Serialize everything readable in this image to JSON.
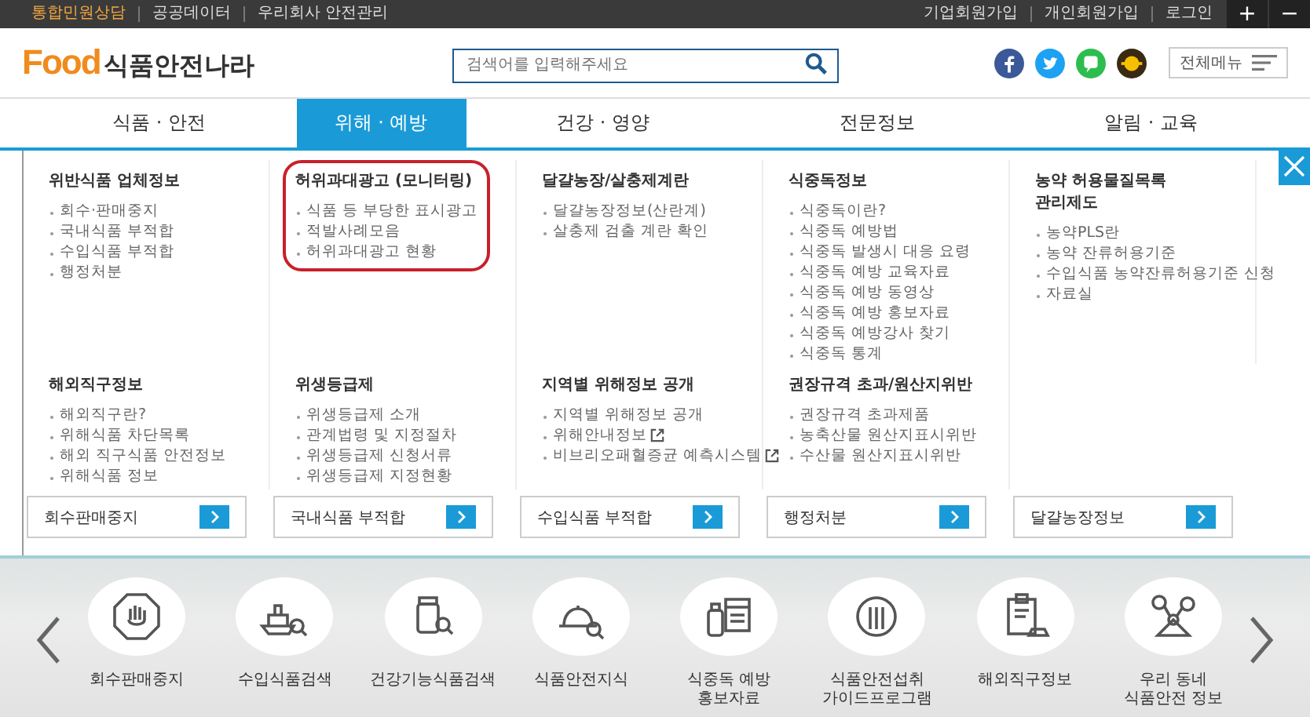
{
  "top_bar": {
    "left_links": [
      {
        "label": "통합민원상담",
        "highlight": true
      },
      {
        "label": "공공데이터",
        "highlight": false
      },
      {
        "label": "우리회사 안전관리",
        "highlight": false
      }
    ],
    "right_links": [
      "기업회원가입",
      "개인회원가입",
      "로그인"
    ],
    "zoom_buttons": [
      "+",
      "−"
    ]
  },
  "header": {
    "logo": {
      "mark": "Food",
      "name": "식품안전나라"
    },
    "search": {
      "placeholder": "검색어를 입력해주세요"
    },
    "social": [
      {
        "kind": "facebook"
      },
      {
        "kind": "twitter"
      },
      {
        "kind": "chat"
      },
      {
        "kind": "coin"
      }
    ],
    "all_menu": "전체메뉴"
  },
  "nav": [
    {
      "label": "식품 · 안전",
      "selected": false
    },
    {
      "label": "위해 · 예방",
      "selected": true
    },
    {
      "label": "건강 · 영양",
      "selected": false
    },
    {
      "label": "전문정보",
      "selected": false
    },
    {
      "label": "알림 · 교육",
      "selected": false
    }
  ],
  "mega_menu": {
    "rows": [
      [
        {
          "title": "위반식품 업체정보",
          "highlighted": false,
          "items": [
            {
              "label": "회수·판매중지",
              "external": false
            },
            {
              "label": "국내식품 부적합",
              "external": false
            },
            {
              "label": "수입식품 부적합",
              "external": false
            },
            {
              "label": "행정처분",
              "external": false
            }
          ]
        },
        {
          "title": "허위과대광고 (모니터링)",
          "highlighted": true,
          "items": [
            {
              "label": "식품 등 부당한 표시광고",
              "external": false
            },
            {
              "label": "적발사례모음",
              "external": false
            },
            {
              "label": "허위과대광고 현황",
              "external": false
            }
          ]
        },
        {
          "title": "달걀농장/살충제계란",
          "highlighted": false,
          "items": [
            {
              "label": "달걀농장정보(산란계)",
              "external": false
            },
            {
              "label": "살충제 검출 계란 확인",
              "external": false
            }
          ]
        },
        {
          "title": "식중독정보",
          "highlighted": false,
          "items": [
            {
              "label": "식중독이란?",
              "external": false
            },
            {
              "label": "식중독 예방법",
              "external": false
            },
            {
              "label": "식중독 발생시 대응 요령",
              "external": false
            },
            {
              "label": "식중독 예방 교육자료",
              "external": false
            },
            {
              "label": "식중독 예방 동영상",
              "external": false
            },
            {
              "label": "식중독 예방 홍보자료",
              "external": false
            },
            {
              "label": "식중독 예방강사 찾기",
              "external": false
            },
            {
              "label": "식중독 통계",
              "external": false
            }
          ]
        },
        {
          "title": "농약 허용물질목록\n관리제도",
          "highlighted": false,
          "items": [
            {
              "label": "농약PLS란",
              "external": false
            },
            {
              "label": "농약 잔류허용기준",
              "external": false
            },
            {
              "label": "수입식품 농약잔류허용기준 신청",
              "external": false
            },
            {
              "label": "자료실",
              "external": false
            }
          ]
        }
      ],
      [
        {
          "title": "해외직구정보",
          "highlighted": false,
          "items": [
            {
              "label": "해외직구란?",
              "external": false
            },
            {
              "label": "위해식품 차단목록",
              "external": false
            },
            {
              "label": "해외 직구식품 안전정보",
              "external": false
            },
            {
              "label": "위해식품 정보",
              "external": false
            }
          ]
        },
        {
          "title": "위생등급제",
          "highlighted": false,
          "items": [
            {
              "label": "위생등급제 소개",
              "external": false
            },
            {
              "label": "관계법령 및 지정절차",
              "external": false
            },
            {
              "label": "위생등급제 신청서류",
              "external": false
            },
            {
              "label": "위생등급제 지정현황",
              "external": false
            }
          ]
        },
        {
          "title": "지역별 위해정보 공개",
          "highlighted": false,
          "items": [
            {
              "label": "지역별 위해정보 공개",
              "external": false
            },
            {
              "label": "위해안내정보",
              "external": true
            },
            {
              "label": "비브리오패혈증균 예측시스템",
              "external": true
            }
          ]
        },
        {
          "title": "권장규격 초과/원산지위반",
          "highlighted": false,
          "items": [
            {
              "label": "권장규격 초과제품",
              "external": false
            },
            {
              "label": "농축산물 원산지표시위반",
              "external": false
            },
            {
              "label": "수산물 원산지표시위반",
              "external": false
            }
          ]
        }
      ]
    ],
    "quick_buttons": [
      "회수판매중지",
      "국내식품 부적합",
      "수입식품 부적합",
      "행정처분",
      "달걀농장정보"
    ]
  },
  "carousel": {
    "items": [
      {
        "kind": "stop",
        "label": "회수판매중지"
      },
      {
        "kind": "ship",
        "label": "수입식품검색"
      },
      {
        "kind": "jar",
        "label": "건강기능식품검색"
      },
      {
        "kind": "cloche",
        "label": "식품안전지식"
      },
      {
        "kind": "bottle",
        "label": "식중독 예방\n홍보자료"
      },
      {
        "kind": "plate",
        "label": "식품안전섭취\n가이드프로그램"
      },
      {
        "kind": "clipboard",
        "label": "해외직구정보"
      },
      {
        "kind": "network",
        "label": "우리 동네\n식품안전 정보"
      }
    ]
  }
}
